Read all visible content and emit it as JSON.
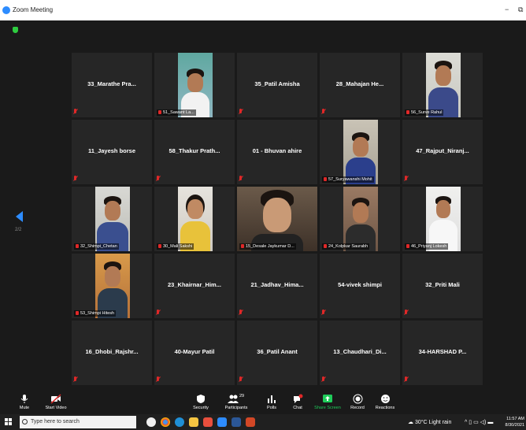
{
  "window": {
    "title": "Zoom Meeting",
    "minimize": "−",
    "restore": "⧉"
  },
  "page_indicator": "2/2",
  "tiles": [
    {
      "name": "33_Marathe Pra..."
    },
    {
      "label": "51_Sawant La..."
    },
    {
      "name": "35_Patil Amisha"
    },
    {
      "name": "28_Mahajan He..."
    },
    {
      "label": "56_Surve Rahul"
    },
    {
      "name": "11_Jayesh borse"
    },
    {
      "name": "58_Thakur Prath..."
    },
    {
      "name": "01 - Bhuvan ahire"
    },
    {
      "label": "57_Suryawanshi Mohit"
    },
    {
      "name": "47_Rajput_Niranj..."
    },
    {
      "label": "32_Shimpi_Chetan"
    },
    {
      "label": "30_Mali Sakshi"
    },
    {
      "label": "15_Desale Jaykumar D..."
    },
    {
      "label": "24_Kolpkar Saurabh"
    },
    {
      "label": "46_Priyanj Lokesh"
    },
    {
      "label": "53_Shimpi Hitesh"
    },
    {
      "name": "23_Khairnar_Him..."
    },
    {
      "name": "21_Jadhav_Hima..."
    },
    {
      "name": "54-vivek shimpi"
    },
    {
      "name": "32_Priti Mali"
    },
    {
      "name": "16_Dhobi_Rajshr..."
    },
    {
      "name": "40-Mayur Patil"
    },
    {
      "name": "36_Patil Anant"
    },
    {
      "name": "13_Chaudhari_Di..."
    },
    {
      "name": "34-HARSHAD P..."
    }
  ],
  "toolbar": {
    "mute": "Mute",
    "start_video": "Start Video",
    "security": "Security",
    "participants": "Participants",
    "participants_count": "29",
    "polls": "Polls",
    "chat": "Chat",
    "share_screen": "Share Screen",
    "record": "Record",
    "reactions": "Reactions"
  },
  "taskbar": {
    "search_placeholder": "Type here to search",
    "weather": "30°C  Light rain",
    "time": "11:57 AM",
    "date": "8/30/2021"
  },
  "colors": {
    "accent": "#2d8cff",
    "share_green": "#1fcc5a",
    "muted_red": "#e02828",
    "tile_bg": "#262626"
  }
}
